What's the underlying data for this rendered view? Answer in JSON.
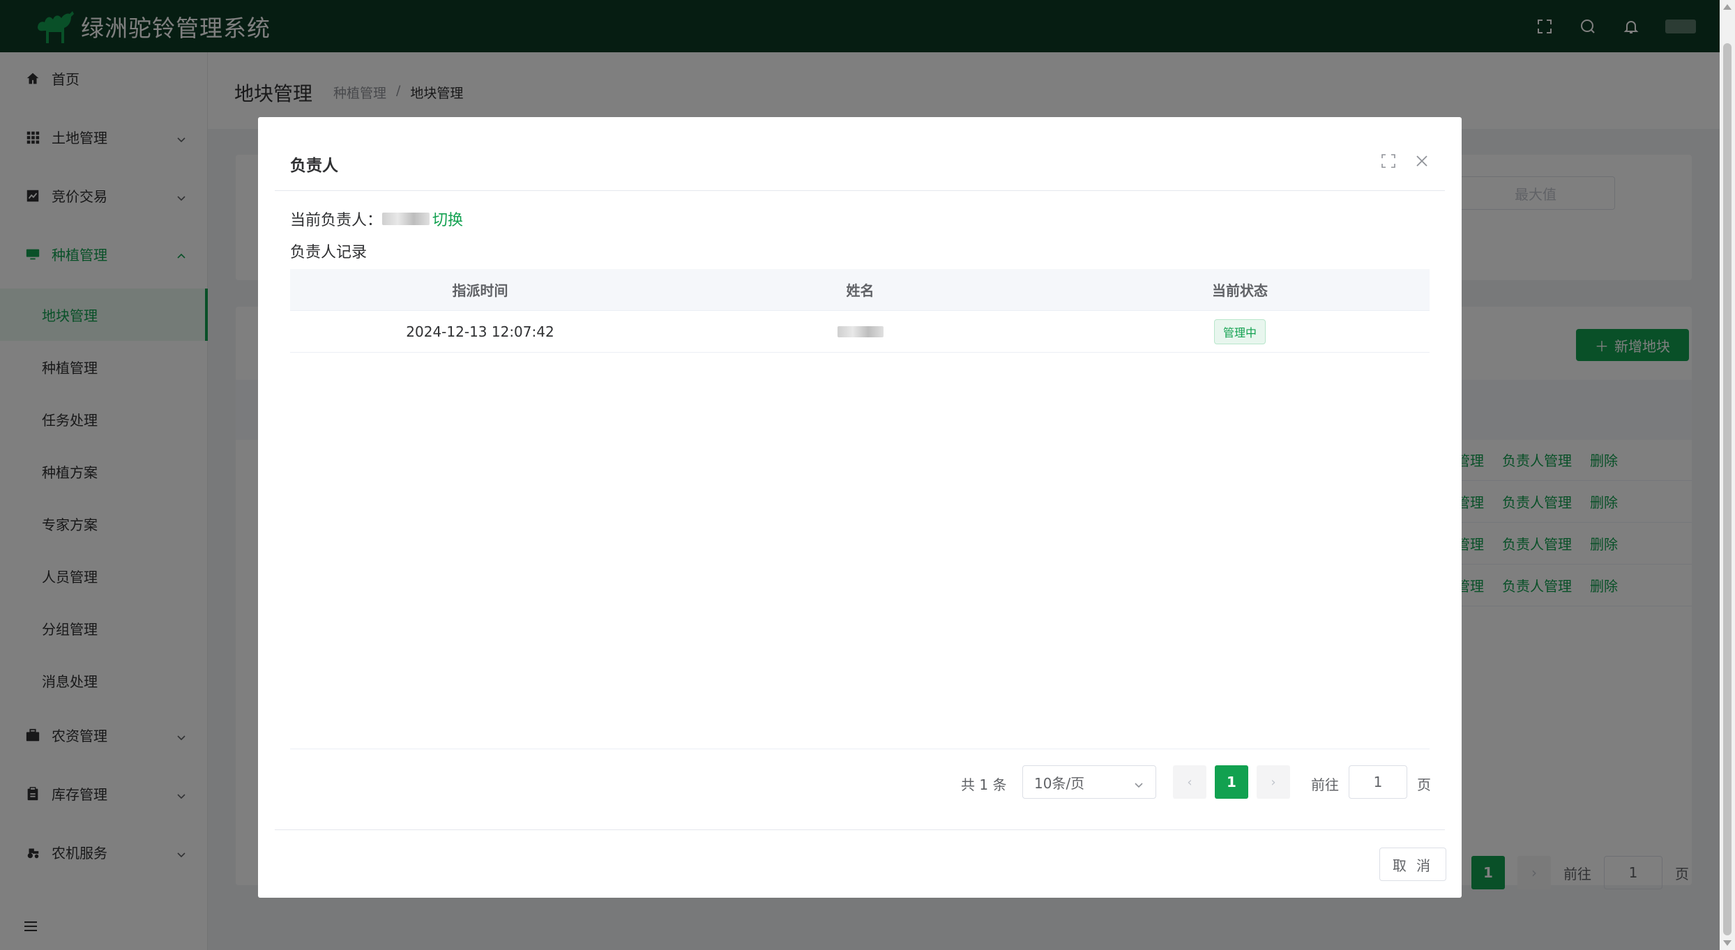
{
  "app": {
    "title": "绿洲驼铃管理系统"
  },
  "sidebar": {
    "items": [
      {
        "label": "首页",
        "icon": "home-icon"
      },
      {
        "label": "土地管理",
        "icon": "grid-icon"
      },
      {
        "label": "竞价交易",
        "icon": "chart-icon"
      },
      {
        "label": "种植管理",
        "icon": "monitor-icon"
      },
      {
        "label": "农资管理",
        "icon": "briefcase-icon"
      },
      {
        "label": "库存管理",
        "icon": "clipboard-icon"
      },
      {
        "label": "农机服务",
        "icon": "tractor-icon"
      }
    ],
    "submenu": [
      {
        "label": "地块管理"
      },
      {
        "label": "种植管理"
      },
      {
        "label": "任务处理"
      },
      {
        "label": "种植方案"
      },
      {
        "label": "专家方案"
      },
      {
        "label": "人员管理"
      },
      {
        "label": "分组管理"
      },
      {
        "label": "消息处理"
      }
    ]
  },
  "page": {
    "title": "地块管理",
    "breadcrumb": [
      "种植管理",
      "/",
      "地块管理"
    ],
    "max_placeholder": "最大值",
    "add_button": "新增地块",
    "row_actions": [
      {
        "manage": "管理",
        "owner": "负责人管理",
        "delete": "删除"
      },
      {
        "manage": "管理",
        "owner": "负责人管理",
        "delete": "删除"
      },
      {
        "manage": "管理",
        "owner": "负责人管理",
        "delete": "删除"
      },
      {
        "manage": "管理",
        "owner": "负责人管理",
        "delete": "删除"
      }
    ],
    "pager": {
      "current": "1",
      "goto_label": "前往",
      "goto_value": "1",
      "page_label": "页"
    }
  },
  "dialog": {
    "title": "负责人",
    "current_owner_label": "当前负责人：",
    "switch_link": "切换",
    "records_label": "负责人记录",
    "table": {
      "headers": [
        "指派时间",
        "姓名",
        "当前状态"
      ],
      "rows": [
        {
          "time": "2024-12-13 12:07:42",
          "name": "",
          "status": "管理中"
        }
      ]
    },
    "pager": {
      "total": "共 1 条",
      "page_size": "10条/页",
      "current": "1",
      "goto_label": "前往",
      "goto_value": "1",
      "page_label": "页"
    },
    "cancel_button": "取 消"
  },
  "colors": {
    "primary": "#12a150",
    "topbar": "#0d3b24"
  }
}
